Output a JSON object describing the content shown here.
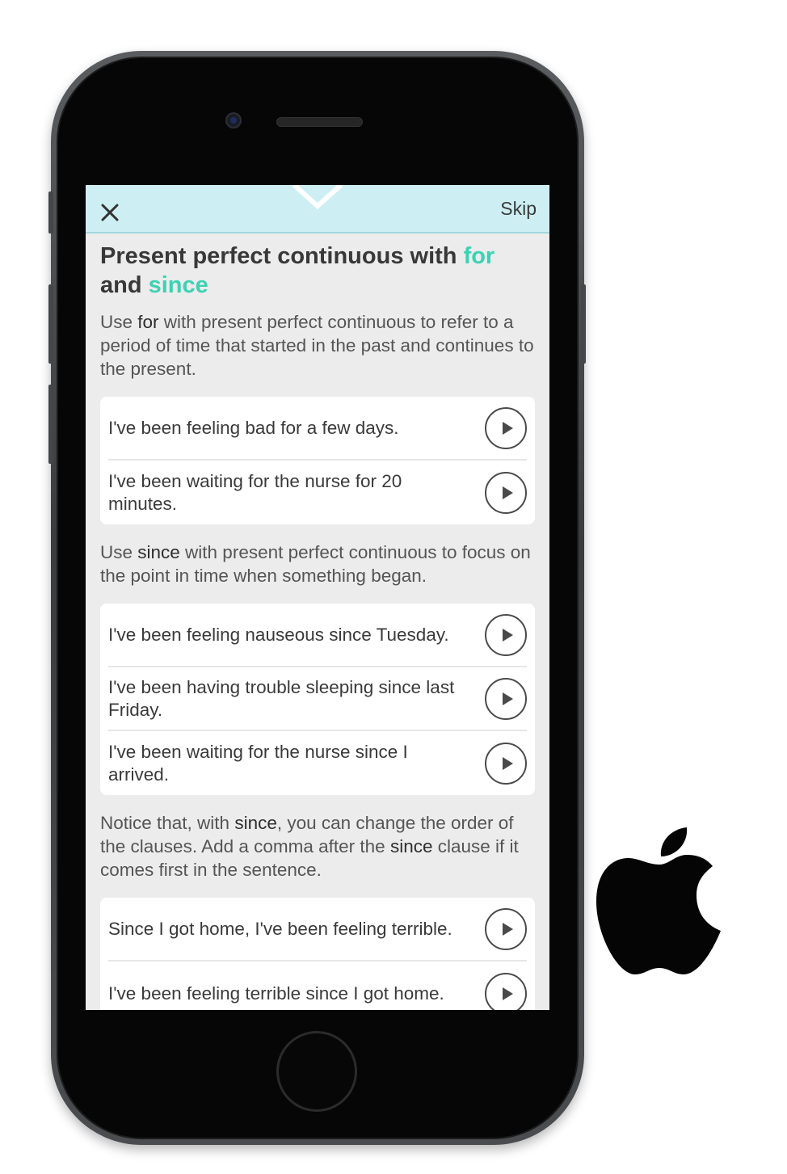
{
  "topbar": {
    "skip_label": "Skip"
  },
  "title": {
    "part1": "Present perfect continuous with ",
    "for": "for",
    "and": " and ",
    "since": "since"
  },
  "intro_for": {
    "pre": "Use ",
    "kw": "for",
    "post": " with present perfect continuous to refer to a period of time that started in the past and continues to the present."
  },
  "examples_for": [
    "I've been feeling bad for a few days.",
    "I've been waiting for the nurse for 20 minutes."
  ],
  "intro_since": {
    "pre": "Use ",
    "kw": "since",
    "post": " with present perfect continuous to focus on the point in time when something began."
  },
  "examples_since": [
    "I've been feeling nauseous since Tuesday.",
    "I've been having trouble sleeping since last Friday.",
    "I've been waiting for the nurse since I arrived."
  ],
  "notice": {
    "pre": "Notice that, with ",
    "kw1": "since",
    "mid": ", you can change the order of the clauses. Add a comma after the ",
    "kw2": "since",
    "post": " clause if it comes first in the sentence."
  },
  "examples_order": [
    "Since I got home, I've been feeling terrible.",
    "I've been feeling terrible since I got home."
  ],
  "colors": {
    "accent": "#3dd1b4",
    "topbar": "#cdeff3"
  },
  "icons": {
    "close": "close-icon",
    "play": "play-icon",
    "chevron": "chevron-down-icon",
    "logo": "apple-logo-icon"
  }
}
